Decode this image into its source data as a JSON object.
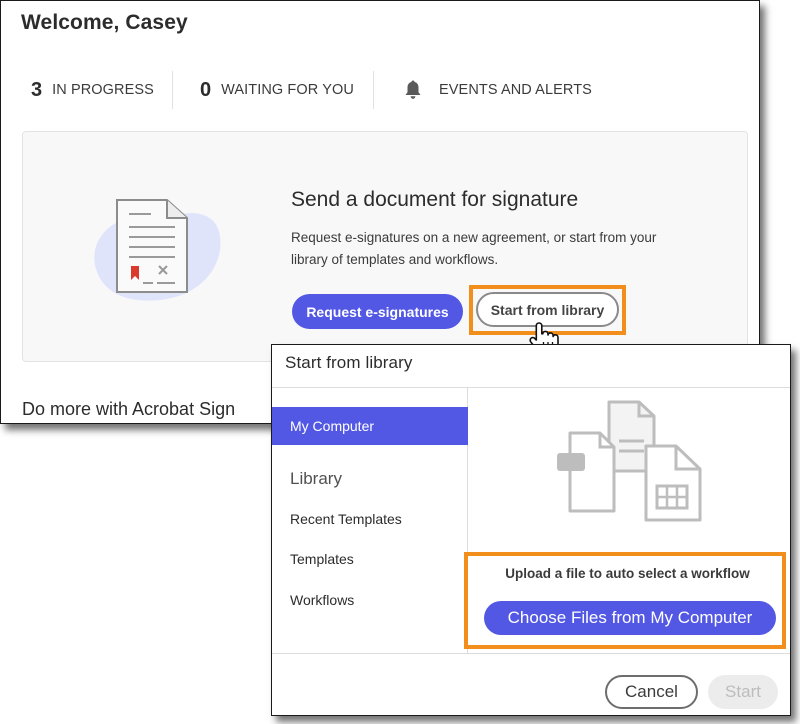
{
  "main": {
    "welcome": "Welcome, Casey",
    "stats": [
      {
        "count": "3",
        "label": "IN PROGRESS"
      },
      {
        "count": "0",
        "label": "WAITING FOR YOU"
      },
      {
        "label": "EVENTS AND ALERTS",
        "icon": "bell-icon"
      }
    ],
    "card": {
      "title": "Send a document for signature",
      "description": "Request e-signatures on a new agreement, or start from your library of templates and workflows.",
      "request_button": "Request e-signatures",
      "library_button": "Start from library"
    },
    "do_more": "Do more with Acrobat Sign"
  },
  "dialog": {
    "title": "Start from library",
    "nav_active": "My Computer",
    "nav_heading": "Library",
    "nav_items": [
      "Recent Templates",
      "Templates",
      "Workflows"
    ],
    "upload_text": "Upload a file to auto select a workflow",
    "choose_button": "Choose Files from My Computer",
    "cancel_button": "Cancel",
    "start_button": "Start"
  },
  "colors": {
    "accent": "#5258e4",
    "highlight": "#f28e1c",
    "card_bg": "#f8f8f8"
  }
}
